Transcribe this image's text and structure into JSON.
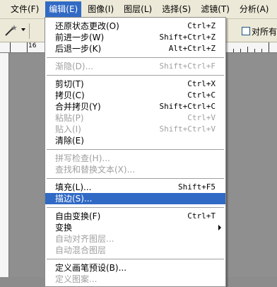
{
  "menubar": {
    "items": [
      {
        "label": "文件(F)"
      },
      {
        "label": "编辑(E)"
      },
      {
        "label": "图像(I)"
      },
      {
        "label": "图层(L)"
      },
      {
        "label": "选择(S)"
      },
      {
        "label": "滤镜(T)"
      },
      {
        "label": "分析(A)"
      }
    ],
    "active_index": 1
  },
  "options_bar": {
    "tool_icon": "magic-wand-icon",
    "checkbox_label": "对所有"
  },
  "ruler": {
    "visible_number": "16"
  },
  "edit_menu": {
    "items": [
      {
        "label": "还原状态更改(O)",
        "shortcut": "Ctrl+Z",
        "enabled": true
      },
      {
        "label": "前进一步(W)",
        "shortcut": "Shift+Ctrl+Z",
        "enabled": true
      },
      {
        "label": "后退一步(K)",
        "shortcut": "Alt+Ctrl+Z",
        "enabled": true
      },
      {
        "label": "渐隐(D)...",
        "shortcut": "Shift+Ctrl+F",
        "enabled": false
      },
      {
        "label": "剪切(T)",
        "shortcut": "Ctrl+X",
        "enabled": true
      },
      {
        "label": "拷贝(C)",
        "shortcut": "Ctrl+C",
        "enabled": true
      },
      {
        "label": "合并拷贝(Y)",
        "shortcut": "Shift+Ctrl+C",
        "enabled": true
      },
      {
        "label": "粘贴(P)",
        "shortcut": "Ctrl+V",
        "enabled": false
      },
      {
        "label": "贴入(I)",
        "shortcut": "Shift+Ctrl+V",
        "enabled": false
      },
      {
        "label": "清除(E)",
        "shortcut": "",
        "enabled": true
      },
      {
        "label": "拼写检查(H)...",
        "shortcut": "",
        "enabled": false
      },
      {
        "label": "查找和替换文本(X)...",
        "shortcut": "",
        "enabled": false
      },
      {
        "label": "填充(L)...",
        "shortcut": "Shift+F5",
        "enabled": true
      },
      {
        "label": "描边(S)...",
        "shortcut": "",
        "enabled": true,
        "highlighted": true
      },
      {
        "label": "自由变换(F)",
        "shortcut": "Ctrl+T",
        "enabled": true
      },
      {
        "label": "变换",
        "shortcut": "",
        "enabled": true,
        "submenu": true
      },
      {
        "label": "自动对齐图层...",
        "shortcut": "",
        "enabled": false
      },
      {
        "label": "自动混合图层",
        "shortcut": "",
        "enabled": false
      },
      {
        "label": "定义画笔预设(B)...",
        "shortcut": "",
        "enabled": true
      },
      {
        "label": "定义图案...",
        "shortcut": "",
        "enabled": false
      }
    ]
  },
  "colors": {
    "highlight": "#316ac5",
    "menubar_bg": "#ece9d8",
    "disabled_text": "#a0a0a0",
    "canvas_bg": "#8f8f8f"
  }
}
